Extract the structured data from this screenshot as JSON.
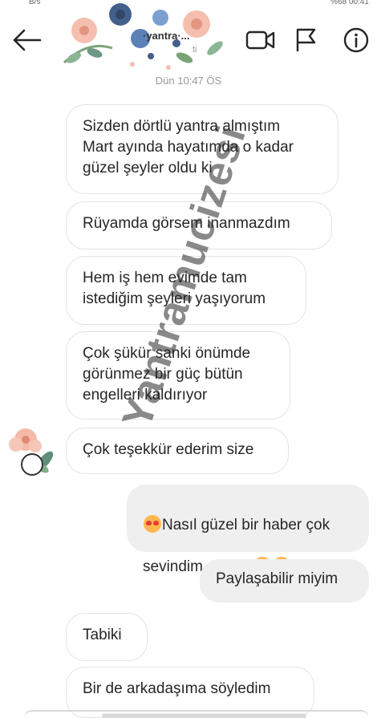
{
  "status_bar": {
    "left_text": "B/s",
    "right_text": "%68  00:41"
  },
  "header": {
    "name": "·yantra·...",
    "subtitle": "ti",
    "icons": {
      "back": "arrow-left-icon",
      "video": "video-camera-icon",
      "flag": "flag-icon",
      "info": "info-icon"
    }
  },
  "timestamp": "Dün 10:47 ÖS",
  "messages": [
    {
      "side": "in",
      "text": "Sizden dörtlü yantra almıştım\nMart ayında hayatımda o kadar\ngüzel şeyler oldu ki"
    },
    {
      "side": "in",
      "text": "Rüyamda görsem inanmazdım"
    },
    {
      "side": "in",
      "text": "Hem iş hem evimde tam\nistediğim şeyleri yaşıyorum"
    },
    {
      "side": "in",
      "text": "Çok şükür sanki önümde\ngörünmez bir güç bütün\nengelleri kaldırıyor"
    },
    {
      "side": "in",
      "text": "Çok teşekkür ederim size"
    },
    {
      "side": "out",
      "text_line1": "Nasıl güzel bir haber çok",
      "text_line2": "sevindim canım"
    },
    {
      "side": "out",
      "text": "Paylaşabilir miyim"
    },
    {
      "side": "in",
      "text": "Tabiki"
    },
    {
      "side": "in",
      "text": "Bir de arkadaşıma söyledim"
    }
  ],
  "watermark": "Yantramucizesi",
  "colors": {
    "incoming_bubble_border": "#e3e3e3",
    "outgoing_bubble_bg": "#efefef",
    "text": "#262626",
    "meta_text": "#999999"
  }
}
